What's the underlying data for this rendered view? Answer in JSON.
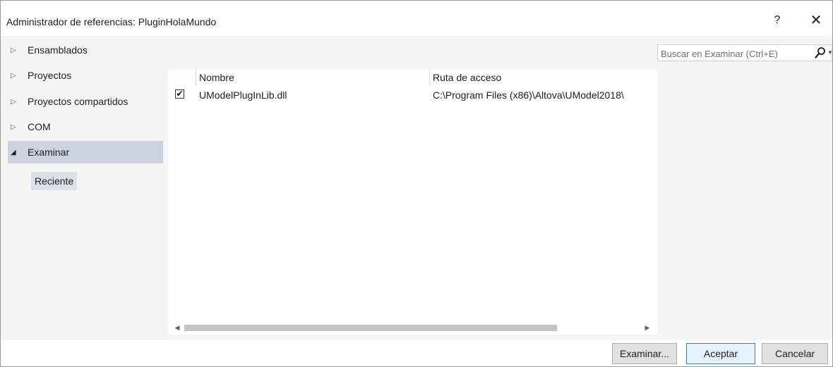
{
  "window": {
    "title": "Administrador de referencias: PluginHolaMundo",
    "help_label": "?",
    "close_label": "✕"
  },
  "nav": {
    "items": [
      {
        "label": "Ensamblados",
        "expanded": false
      },
      {
        "label": "Proyectos",
        "expanded": false
      },
      {
        "label": "Proyectos compartidos",
        "expanded": false
      },
      {
        "label": "COM",
        "expanded": false
      },
      {
        "label": "Examinar",
        "expanded": true,
        "selected": true
      }
    ],
    "sub_items": [
      {
        "label": "Reciente"
      }
    ]
  },
  "list": {
    "columns": [
      "Nombre",
      "Ruta de acceso"
    ],
    "rows": [
      {
        "checked": true,
        "name": "UModelPlugInLib.dll",
        "path": "C:\\Program Files (x86)\\Altova\\UModel2018\\"
      }
    ]
  },
  "search": {
    "placeholder": "Buscar en Examinar (Ctrl+E)"
  },
  "footer": {
    "browse_label": "Examinar...",
    "ok_label": "Aceptar",
    "cancel_label": "Cancelar"
  },
  "icons": {
    "collapsed": "arrow-right-icon",
    "expanded": "arrow-down-icon",
    "search": "search-icon"
  },
  "colors": {
    "selected_nav": "#ccd2de",
    "content_bg": "#f5f5f5",
    "primary_border": "#3c7fb1"
  }
}
